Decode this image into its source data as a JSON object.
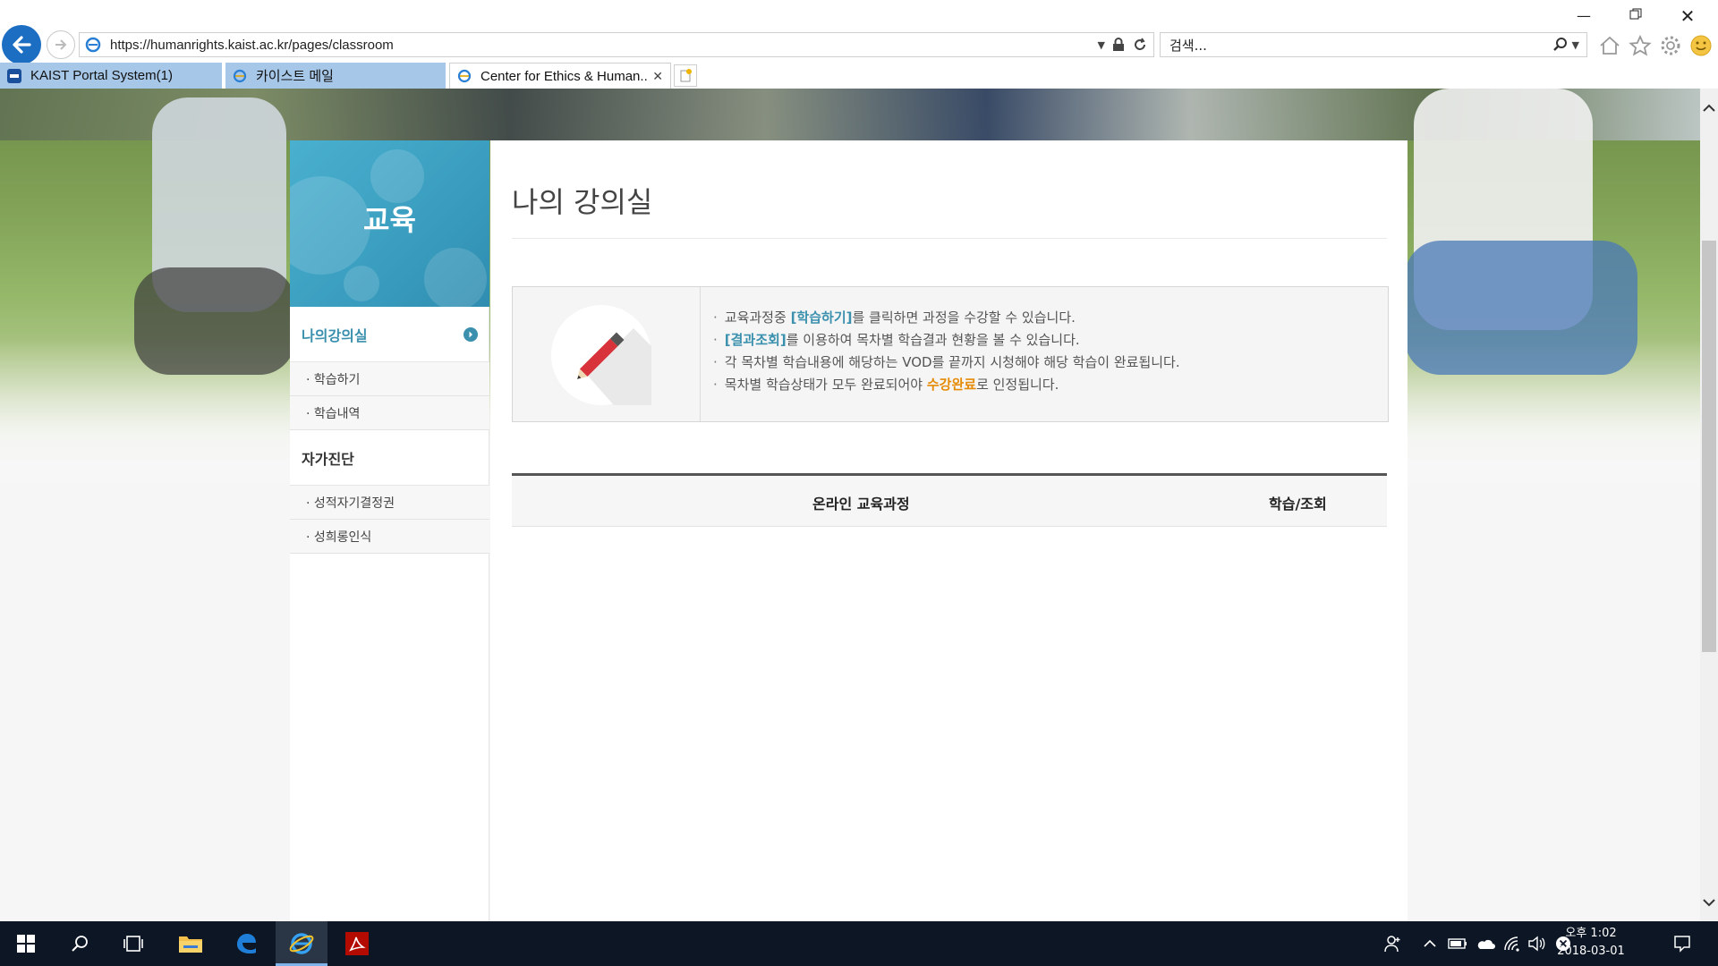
{
  "browser": {
    "url": "https://humanrights.kaist.ac.kr/pages/classroom",
    "search_placeholder": "검색...",
    "tabs": [
      {
        "label": "KAIST Portal System(1)",
        "active": false
      },
      {
        "label": "카이스트 메일",
        "active": false
      },
      {
        "label": "Center for Ethics & Human...",
        "active": true
      }
    ]
  },
  "sidebar": {
    "banner_title": "교육",
    "sections": [
      {
        "label": "나의강의실",
        "active": true,
        "items": [
          "· 학습하기",
          "· 학습내역"
        ]
      },
      {
        "label": "자가진단",
        "active": false,
        "items": [
          "· 성적자기결정권",
          "· 성희롱인식"
        ]
      }
    ]
  },
  "main": {
    "title": "나의 강의실",
    "notice": {
      "line1_pre": "교육과정중 ",
      "line1_hl": "[학습하기]",
      "line1_post": "를 클릭하면 과정을 수강할 수 있습니다.",
      "line2_hl": "[결과조회]",
      "line2_post": "를 이용하여 목차별 학습결과 현황을 볼 수 있습니다.",
      "line3": "각 목차별 학습내용에 해당하는 VOD를 끝까지 시청해야 해당 학습이 완료됩니다.",
      "line4_pre": "목차별 학습상태가 모두 완료되어야 ",
      "line4_hl": "수강완료",
      "line4_post": "로 인정됩니다.",
      "bullet": "·"
    },
    "table": {
      "headers": [
        "온라인 교육과정",
        "학습/조회"
      ]
    }
  },
  "taskbar": {
    "time": "오후 1:02",
    "date": "2018-03-01"
  },
  "colors": {
    "accent_blue": "#3a90ad",
    "accent_orange": "#e58b07",
    "banner": "#4ab0cf"
  }
}
